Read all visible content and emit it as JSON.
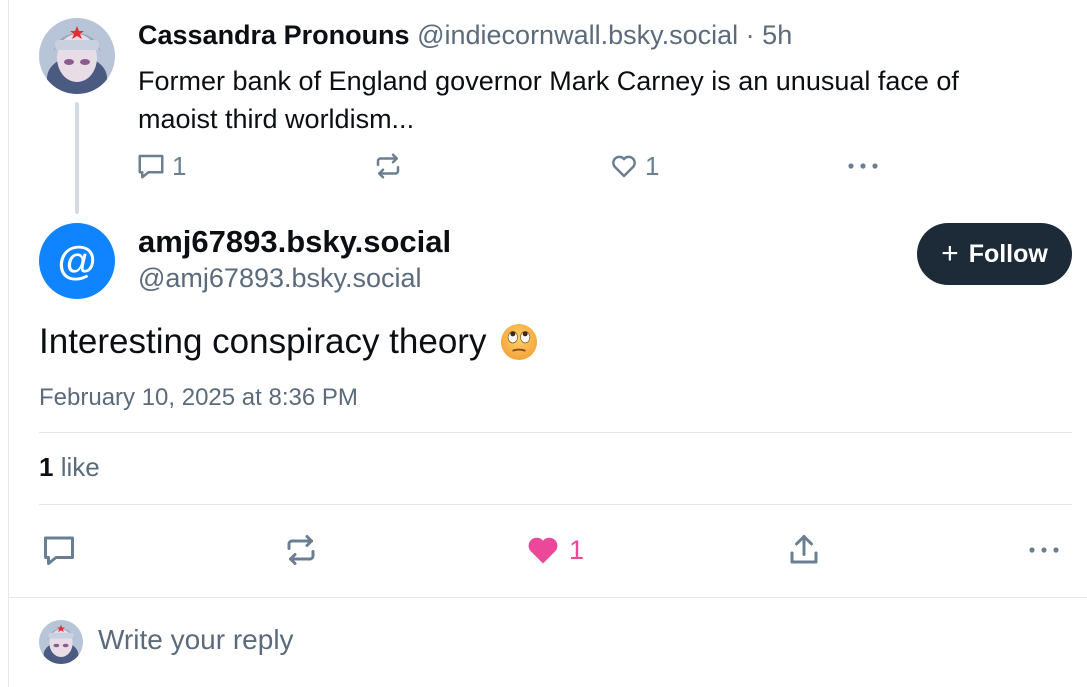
{
  "parent_post": {
    "author_name": "Cassandra Pronouns",
    "author_handle": "@indiecornwall.bsky.social",
    "separator": "·",
    "time": "5h",
    "text": "Former bank of England governor Mark Carney is an unusual face of maoist third worldism...",
    "reply_count": "1",
    "like_count": "1",
    "avatar_icon": "robot-girl-avatar"
  },
  "main_post": {
    "author_name": "amj67893.bsky.social",
    "author_handle": "@amj67893.bsky.social",
    "avatar_glyph": "@",
    "avatar_color": "#1083fe",
    "follow_label": "Follow",
    "text": "Interesting conspiracy theory",
    "emoji": "face-with-rolling-eyes",
    "date": "February 10, 2025 at 8:36 PM",
    "likes_count": "1",
    "likes_label": "like",
    "liked_count": "1",
    "like_color": "#ec4899"
  },
  "reply_bar": {
    "placeholder": "Write your reply"
  }
}
